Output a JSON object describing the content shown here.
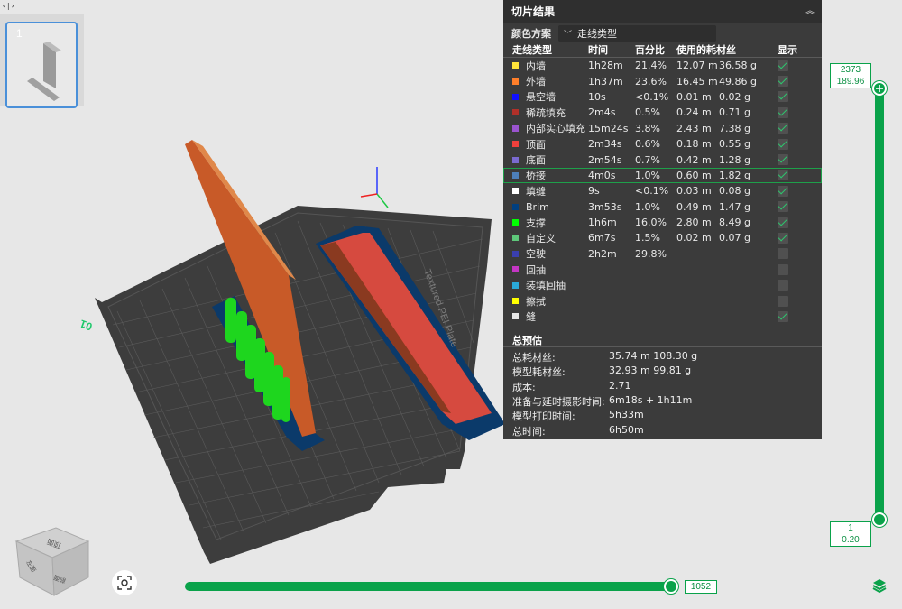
{
  "plate": {
    "number": "1",
    "bed_label": "Textured PEI Plate",
    "plate_id": "01"
  },
  "viewcube": {
    "top": "顶面",
    "front": "前面",
    "left": "左面"
  },
  "panel": {
    "title": "切片结果",
    "color_scheme_label": "颜色方案",
    "color_scheme_value": "走线类型",
    "headers": {
      "type": "走线类型",
      "time": "时间",
      "percent": "百分比",
      "filament": "使用的耗材丝",
      "show": "显示"
    },
    "rows": [
      {
        "type": "内墙",
        "color": "#ffe43a",
        "time": "1h28m",
        "percent": "21.4%",
        "length": "12.07 m",
        "weight": "36.58 g",
        "shown": true
      },
      {
        "type": "外墙",
        "color": "#ff7f2a",
        "time": "1h37m",
        "percent": "23.6%",
        "length": "16.45 m",
        "weight": "49.86 g",
        "shown": true
      },
      {
        "type": "悬空墙",
        "color": "#1010ff",
        "time": "10s",
        "percent": "<0.1%",
        "length": "0.01 m",
        "weight": "0.02 g",
        "shown": true
      },
      {
        "type": "稀疏填充",
        "color": "#b03029",
        "time": "2m4s",
        "percent": "0.5%",
        "length": "0.24 m",
        "weight": "0.71 g",
        "shown": true
      },
      {
        "type": "内部实心填充",
        "color": "#9a54cf",
        "time": "15m24s",
        "percent": "3.8%",
        "length": "2.43 m",
        "weight": "7.38 g",
        "shown": true
      },
      {
        "type": "顶面",
        "color": "#f0403c",
        "time": "2m34s",
        "percent": "0.6%",
        "length": "0.18 m",
        "weight": "0.55 g",
        "shown": true
      },
      {
        "type": "底面",
        "color": "#7a6ad0",
        "time": "2m54s",
        "percent": "0.7%",
        "length": "0.42 m",
        "weight": "1.28 g",
        "shown": true
      },
      {
        "type": "桥接",
        "color": "#4d80ba",
        "time": "4m0s",
        "percent": "1.0%",
        "length": "0.60 m",
        "weight": "1.82 g",
        "shown": true,
        "highlight": true
      },
      {
        "type": "填缝",
        "color": "#ffffff",
        "time": "9s",
        "percent": "<0.1%",
        "length": "0.03 m",
        "weight": "0.08 g",
        "shown": true
      },
      {
        "type": "Brim",
        "color": "#003f7f",
        "time": "3m53s",
        "percent": "1.0%",
        "length": "0.49 m",
        "weight": "1.47 g",
        "shown": true
      },
      {
        "type": "支撑",
        "color": "#00ff00",
        "time": "1h6m",
        "percent": "16.0%",
        "length": "2.80 m",
        "weight": "8.49 g",
        "shown": true
      },
      {
        "type": "自定义",
        "color": "#5ec77a",
        "time": "6m7s",
        "percent": "1.5%",
        "length": "0.02 m",
        "weight": "0.07 g",
        "shown": true
      },
      {
        "type": "空驶",
        "color": "#3a3fb0",
        "time": "2h2m",
        "percent": "29.8%",
        "length": "",
        "weight": "",
        "shown": false
      },
      {
        "type": "回抽",
        "color": "#c436c4",
        "time": "",
        "percent": "",
        "length": "",
        "weight": "",
        "shown": false
      },
      {
        "type": "装填回抽",
        "color": "#2aa9d8",
        "time": "",
        "percent": "",
        "length": "",
        "weight": "",
        "shown": false
      },
      {
        "type": "擦拭",
        "color": "#ffff00",
        "time": "",
        "percent": "",
        "length": "",
        "weight": "",
        "shown": false
      },
      {
        "type": "缝",
        "color": "#e6e6e6",
        "time": "",
        "percent": "",
        "length": "",
        "weight": "",
        "shown": true
      }
    ],
    "summary_title": "总预估",
    "summary": [
      {
        "label": "总耗材丝:",
        "value": "35.74 m    108.30 g"
      },
      {
        "label": "模型耗材丝:",
        "value": "32.93 m    99.81 g"
      },
      {
        "label": "成本:",
        "value": "2.71"
      },
      {
        "label": "准备与延时摄影时间:",
        "value": "6m18s + 1h11m"
      },
      {
        "label": "模型打印时间:",
        "value": "5h33m"
      },
      {
        "label": "总时间:",
        "value": "6h50m"
      }
    ]
  },
  "layer_slider": {
    "top_layer": "2373",
    "top_height": "189.96",
    "bottom_layer": "1",
    "bottom_height": "0.20"
  },
  "move_slider": {
    "value": "1052"
  },
  "icons": {
    "corner": "code-toggle-icon",
    "camera": "camera-fit-icon",
    "layers": "layers-icon"
  }
}
